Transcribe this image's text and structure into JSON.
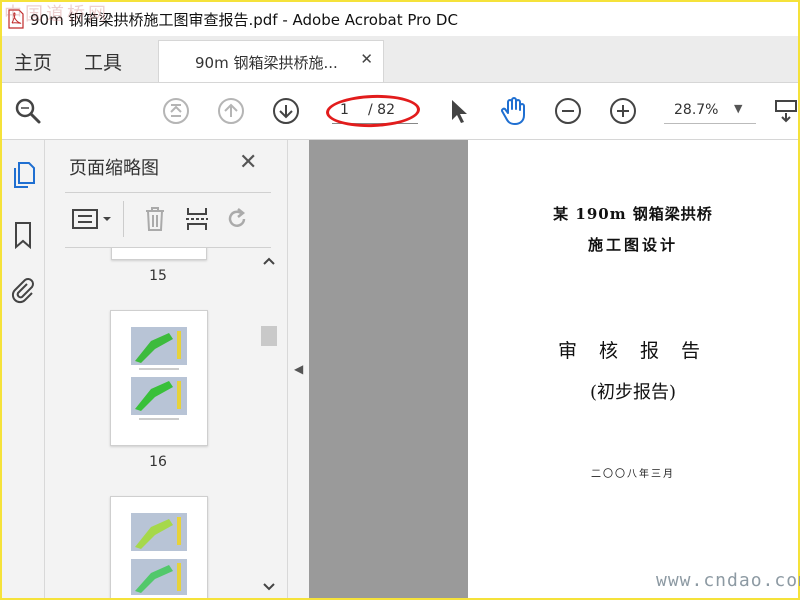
{
  "window": {
    "title": "90m 钢箱梁拱桥施工图审查报告.pdf - Adobe Acrobat Pro DC"
  },
  "tabs": {
    "home": "主页",
    "tools": "工具",
    "document": "90m 钢箱梁拱桥施...",
    "close_glyph": "✕"
  },
  "toolbar": {
    "current_page": "1",
    "total_pages": "/ 82",
    "zoom": "28.7%",
    "zoom_caret": "▼"
  },
  "thumbnail_panel": {
    "title": "页面缩略图",
    "close_glyph": "✕",
    "thumbnails": [
      {
        "page": "15"
      },
      {
        "page": "16"
      }
    ]
  },
  "document": {
    "line1": "某 190m 钢箱梁拱桥",
    "line2": "施工图设计",
    "heading": "审 核 报 告",
    "subheading": "(初步报告)",
    "date": "二〇〇八年三月"
  },
  "watermarks": {
    "top_left": "中国道桥网",
    "bottom_right": "www.cndao.com"
  },
  "colors": {
    "accent_blue": "#1f6fd1",
    "highlight_red": "#e21c1c",
    "frame_yellow": "#f5e23a"
  },
  "icons": [
    "search-zoom-icon",
    "first-page-icon",
    "prev-page-icon",
    "next-page-icon",
    "select-arrow-icon",
    "hand-icon",
    "zoom-out-icon",
    "zoom-in-icon",
    "scroll-mode-icon",
    "thumbnails-icon",
    "bookmark-icon",
    "attachment-icon",
    "options-icon",
    "trash-icon",
    "insert-page-icon",
    "rotate-icon"
  ]
}
